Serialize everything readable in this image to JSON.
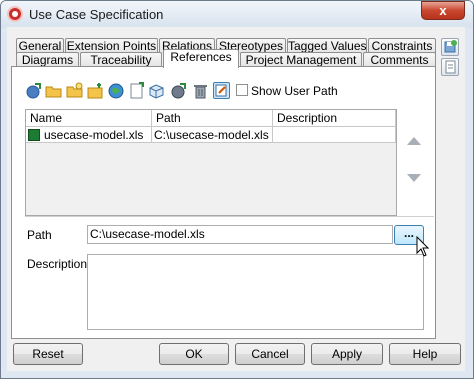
{
  "window": {
    "title": "Use Case Specification",
    "close_glyph": "x"
  },
  "tabs_row1": [
    "General",
    "Extension Points",
    "Relations",
    "Stereotypes",
    "Tagged Values",
    "Constraints"
  ],
  "tabs_row2": [
    "Diagrams",
    "Traceability",
    "References",
    "Project Management",
    "Comments"
  ],
  "active_tab": "References",
  "toolbar": {
    "icons": [
      "add-url-icon",
      "add-file-icon",
      "add-folder-icon",
      "add-model-element-icon",
      "add-diagram-icon",
      "add-shape-icon",
      "add-url-icon",
      "delete-icon",
      "edit-icon"
    ],
    "show_user_path_label": "Show User Path",
    "show_user_path_checked": false
  },
  "table": {
    "columns": [
      "Name",
      "Path",
      "Description"
    ],
    "rows": [
      {
        "name": "usecase-model.xls",
        "path": "C:\\usecase-model.xls",
        "description": ""
      }
    ]
  },
  "form": {
    "path_label": "Path",
    "path_value": "C:\\usecase-model.xls",
    "browse_label": "...",
    "description_label": "Description",
    "description_value": ""
  },
  "buttons": {
    "reset": "Reset",
    "ok": "OK",
    "cancel": "Cancel",
    "apply": "Apply",
    "help": "Help"
  }
}
